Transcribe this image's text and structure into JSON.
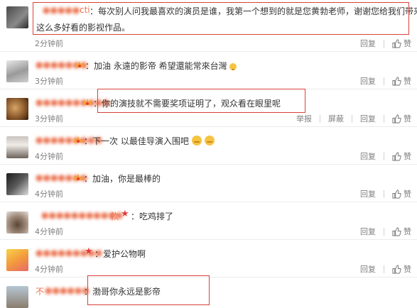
{
  "comments": [
    {
      "name": "cti",
      "text": "每次别人问我最喜欢的演员是谁，我第一个想到的就是您黄勃老师，谢谢您给我们带来",
      "text2": "这么多好看的影视作品。",
      "time": "2分钟前",
      "reply": "回复",
      "like": "赞"
    },
    {
      "name": "",
      "text": "加油 永遠的影帝 希望還能常來台灣",
      "time": "3分钟前",
      "reply": "回复",
      "like": "赞"
    },
    {
      "name": "",
      "text": "你的演技就不需要奖项证明了，观众看在眼里呢",
      "time": "3分钟前",
      "report": "举报",
      "block": "屏蔽",
      "reply": "回复",
      "like": "赞"
    },
    {
      "name": "",
      "text": "下一次 以最佳导演入围吧",
      "time": "4分钟前",
      "reply": "回复",
      "like": "赞"
    },
    {
      "name": "",
      "text": "加油，你是最棒的",
      "time": "4分钟前",
      "reply": "回复",
      "like": "赞"
    },
    {
      "name": "款",
      "text": "吃鸡排了",
      "time": "4分钟前",
      "reply": "回复",
      "like": "赞"
    },
    {
      "name": "",
      "text": "爱护公物啊",
      "time": "4分钟前",
      "reply": "回复",
      "like": "赞"
    },
    {
      "name": "不",
      "text": "渤哥你永远是影帝",
      "time": "",
      "reply": "",
      "like": ""
    }
  ],
  "colors": {
    "accent_name": "#eb7350",
    "highlight_box": "#d9423b"
  },
  "icons": {
    "like": "thumbs-up-icon",
    "vip": "vip-crown-icon",
    "star": "star-icon",
    "emoji": "smile-emoji-icon"
  }
}
